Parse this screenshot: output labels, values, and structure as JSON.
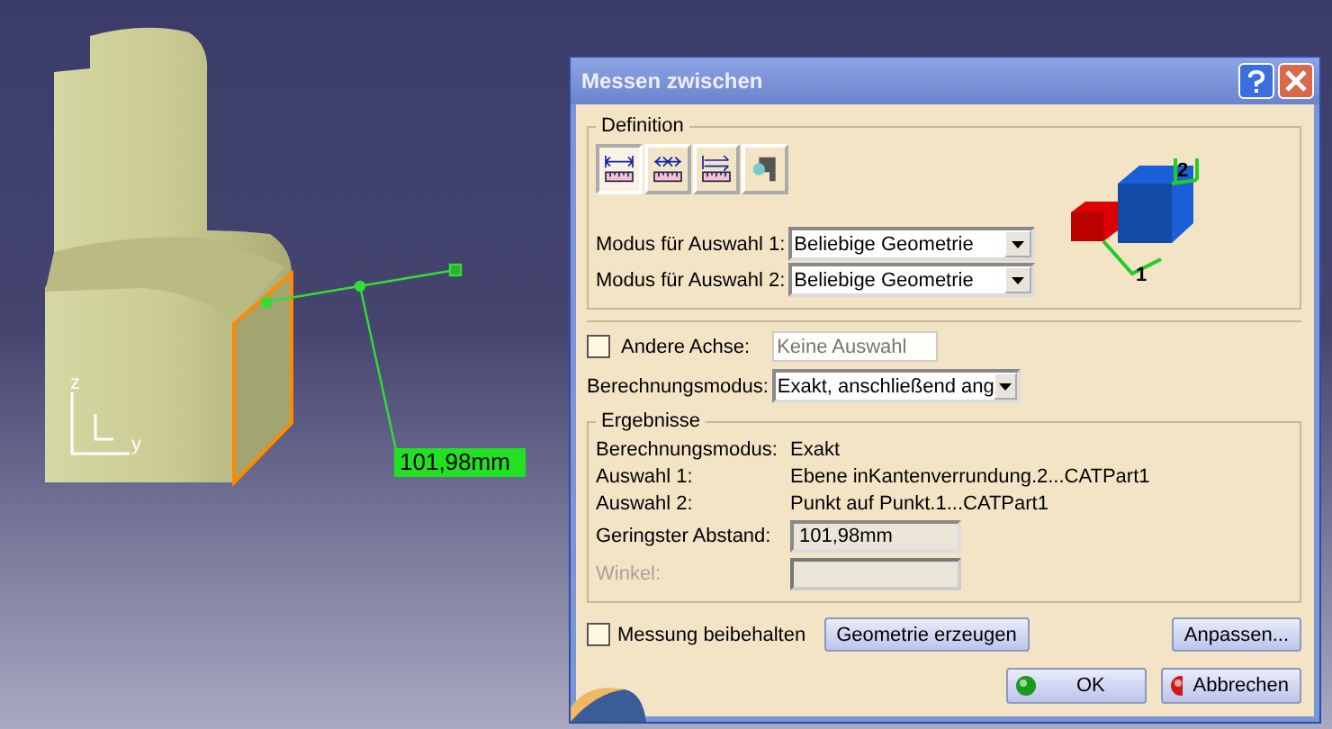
{
  "viewport": {
    "axis_labels": [
      "z",
      "y"
    ],
    "measurement_label": "101,98mm"
  },
  "dialog": {
    "title": "Messen zwischen",
    "definition": {
      "title": "Definition",
      "tools": [
        {
          "kind": "between",
          "selected": true
        },
        {
          "kind": "chain",
          "selected": false
        },
        {
          "kind": "fan",
          "selected": false
        },
        {
          "kind": "item",
          "selected": false
        }
      ],
      "diagram_labels": [
        "1",
        "2"
      ],
      "selection_modes": [
        {
          "label": "Modus für Auswahl 1:",
          "value": "Beliebige Geometrie"
        },
        {
          "label": "Modus für Auswahl 2:",
          "value": "Beliebige Geometrie"
        }
      ]
    },
    "other_axis": {
      "label": "Andere Achse:",
      "checked": false,
      "placeholder": "Keine Auswahl"
    },
    "calc_mode": {
      "label": "Berechnungsmodus:",
      "value": "Exakt, anschließend ang"
    },
    "results": {
      "title": "Ergebnisse",
      "rows": [
        {
          "label": "Berechnungsmodus:",
          "value": "Exakt"
        },
        {
          "label": "Auswahl 1:",
          "value": "Ebene inKantenverrundung.2...CATPart1"
        },
        {
          "label": "Auswahl 2:",
          "value": "Punkt auf Punkt.1...CATPart1"
        }
      ],
      "fields": [
        {
          "label": "Geringster Abstand:",
          "value": "101,98mm",
          "disabled": false
        },
        {
          "label": "Winkel:",
          "disabled": true
        }
      ]
    },
    "keep": {
      "label": "Messung beibehalten",
      "checked": false
    },
    "buttons": [
      {
        "kind": "plain",
        "label": "Geometrie erzeugen"
      },
      {
        "kind": "plain",
        "label": "Anpassen..."
      },
      {
        "kind": "ok",
        "label": "OK"
      },
      {
        "kind": "cancel",
        "label": "Abbrechen"
      }
    ]
  }
}
